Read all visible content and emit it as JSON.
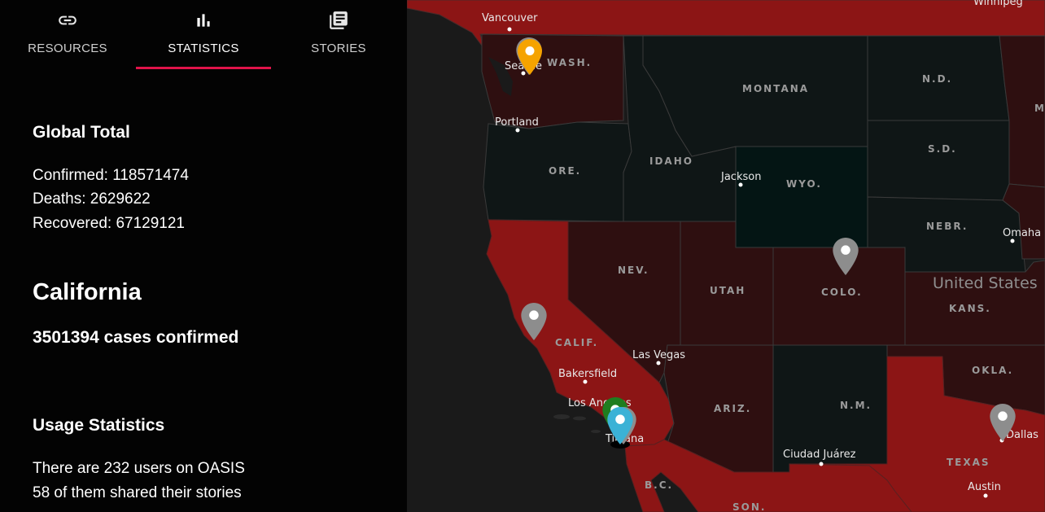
{
  "tabs": [
    {
      "label": "RESOURCES",
      "icon": "link-icon"
    },
    {
      "label": "STATISTICS",
      "icon": "bar-chart-icon"
    },
    {
      "label": "STORIES",
      "icon": "news-icon"
    }
  ],
  "active_tab": "STATISTICS",
  "accent_color": "#e0134a",
  "global": {
    "title": "Global Total",
    "confirmed": "Confirmed: 118571474",
    "deaths": "Deaths: 2629622",
    "recovered": "Recovered: 67129121"
  },
  "region": {
    "name": "California",
    "cases": "3501394 cases confirmed"
  },
  "usage": {
    "title": "Usage Statistics",
    "users": "There are 232 users on OASIS",
    "shared": "58 of them shared their stories"
  },
  "map": {
    "country_label": "United States",
    "state_labels": {
      "wash": "WASH.",
      "ore": "ORE.",
      "calif": "CALIF.",
      "nev": "NEV.",
      "idaho": "IDAHO",
      "montana": "MONTANA",
      "wyo": "WYO.",
      "utah": "UTAH",
      "ariz": "ARIZ.",
      "colo": "COLO.",
      "nm": "N.M.",
      "nd": "N.D.",
      "sd": "S.D.",
      "nebr": "NEBR.",
      "kans": "KANS.",
      "okla": "OKLA.",
      "texas": "TEXAS",
      "bc": "B.C.",
      "son": "SON.",
      "m": "M"
    },
    "cities": {
      "winnipeg": "Winnipeg",
      "vancouver": "Vancouver",
      "seattle": "Seattle",
      "portland": "Portland",
      "jackson": "Jackson",
      "omaha": "Omaha",
      "las_vegas": "Las Vegas",
      "bakersfield": "Bakersfield",
      "los_angeles": "Los Angeles",
      "tijuana": "Tijuana",
      "ciudad_juarez": "Ciudad Juárez",
      "dallas": "Dallas",
      "austin": "Austin"
    },
    "colors": {
      "high": "#8c1515",
      "medium": "#2e0f10",
      "low": "#0f1616",
      "lowest": "#041514",
      "ocean": "#1a1a1a",
      "pin_gray": "#8d8d8d",
      "pin_orange": "#f5a300",
      "pin_blue": "#3bb2d6",
      "pin_green": "#1f7d1f"
    }
  }
}
